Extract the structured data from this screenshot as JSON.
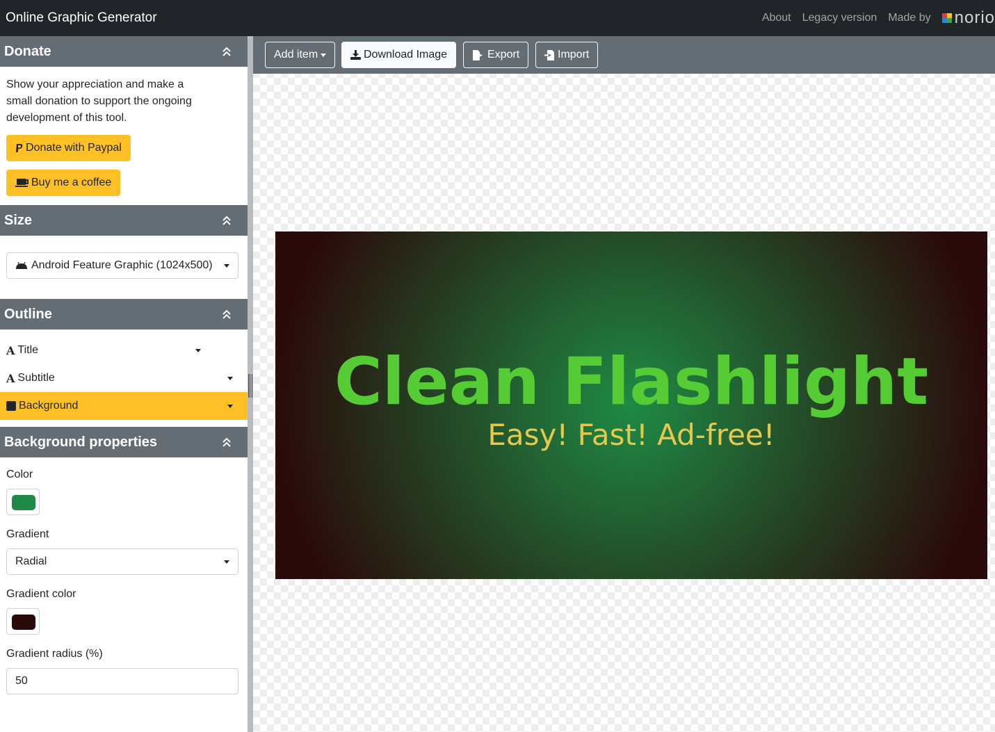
{
  "app": {
    "title": "Online Graphic Generator",
    "nav": {
      "about": "About",
      "legacy": "Legacy version",
      "made_by": "Made by",
      "logo_text": "norio"
    }
  },
  "donate": {
    "header": "Donate",
    "text": "Show your appreciation and make a small donation to support the ongoing development of this tool.",
    "paypal_label": "Donate with Paypal",
    "coffee_label": "Buy me a coffee"
  },
  "size": {
    "header": "Size",
    "selected": "Android Feature Graphic (1024x500)"
  },
  "outline": {
    "header": "Outline",
    "items": [
      {
        "label": "Title",
        "icon": "text-icon"
      },
      {
        "label": "Subtitle",
        "icon": "text-icon"
      },
      {
        "label": "Background",
        "icon": "square-icon",
        "active": true
      }
    ]
  },
  "background_properties": {
    "header": "Background properties",
    "color_label": "Color",
    "color_value": "#1e8a45",
    "gradient_label": "Gradient",
    "gradient_value": "Radial",
    "gradient_color_label": "Gradient color",
    "gradient_color_value": "#2a0a0a",
    "gradient_radius_label": "Gradient radius (%)",
    "gradient_radius_value": "50"
  },
  "toolbar": {
    "add_item": "Add item",
    "download": "Download Image",
    "export": "Export",
    "import": "Import"
  },
  "canvas": {
    "title": "Clean Flashlight",
    "subtitle": "Easy! Fast! Ad-free!",
    "title_color": "#55cc33",
    "subtitle_color": "#e6c84a"
  },
  "colors": {
    "accent": "#ffc026",
    "header_bg": "#656d74",
    "navbar_bg": "#212529"
  }
}
